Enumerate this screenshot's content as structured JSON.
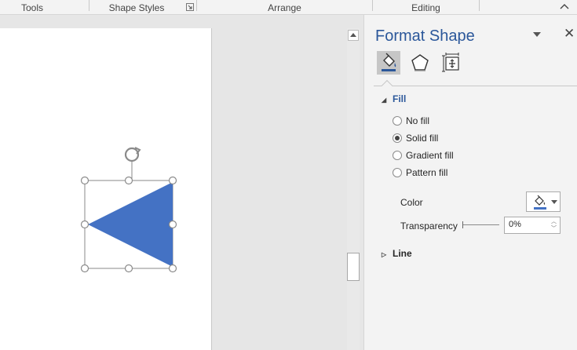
{
  "ribbon": {
    "groups": [
      {
        "label": "Tools"
      },
      {
        "label": "Shape Styles"
      },
      {
        "label": "Arrange"
      },
      {
        "label": "Editing"
      }
    ]
  },
  "shape": {
    "fill_color": "#4472c4"
  },
  "pane": {
    "title": "Format Shape",
    "tabs": [
      {
        "name": "fill-line",
        "icon": "paint-bucket-icon",
        "selected": true
      },
      {
        "name": "effects",
        "icon": "pentagon-icon",
        "selected": false
      },
      {
        "name": "size-properties",
        "icon": "size-properties-icon",
        "selected": false
      }
    ],
    "fill": {
      "heading": "Fill",
      "expanded": true,
      "options": [
        {
          "label": "No fill",
          "selected": false
        },
        {
          "label": "Solid fill",
          "selected": true
        },
        {
          "label": "Gradient fill",
          "selected": false
        },
        {
          "label": "Pattern fill",
          "selected": false
        }
      ],
      "color_label": "Color",
      "color_value": "#4472c4",
      "transparency_label": "Transparency",
      "transparency_value": "0%"
    },
    "line": {
      "heading": "Line",
      "expanded": false
    }
  },
  "colors": {
    "accent": "#2b579a",
    "shape_fill": "#4472c4"
  }
}
